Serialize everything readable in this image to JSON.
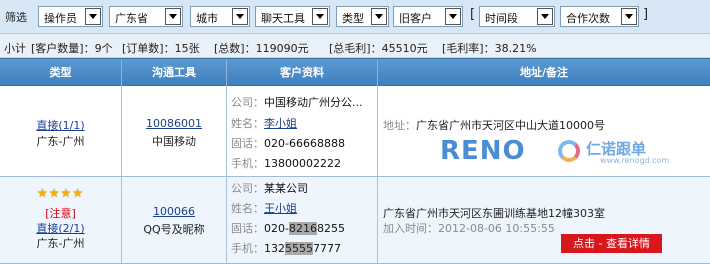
{
  "filters": {
    "label": "筛选",
    "selects": [
      {
        "value": "操作员"
      },
      {
        "value": "广东省"
      },
      {
        "value": "城市"
      },
      {
        "value": "聊天工具"
      },
      {
        "value": "类型"
      },
      {
        "value": "旧客户"
      }
    ],
    "bracket_open": "[",
    "time_select": {
      "value": "时间段"
    },
    "count_select": {
      "value": "合作次数"
    },
    "bracket_close": "]"
  },
  "summary": {
    "label": "小计",
    "customers": "[客户数量]：9个",
    "orders": "[订单数]：15张",
    "total": "[总数]：119090元",
    "profit": "[总毛利]：45510元",
    "margin": "[毛利率]：38.21%"
  },
  "columns": [
    "类型",
    "沟通工具",
    "客户资料",
    "地址/备注"
  ],
  "rows": [
    {
      "type_link": "直接(1/1)",
      "region": "广东-广州",
      "tool_id": "10086001",
      "tool_name": "中国移动",
      "company_key": "公司：",
      "company": "中国移动广州分公...",
      "name_key": "姓名：",
      "name": "李小姐",
      "phone_key": "固话：",
      "phone": "020-66668888",
      "mobile_key": "手机：",
      "mobile": "13800002222",
      "address_key": "地址：",
      "address": "广东省广州市天河区中山大道10000号",
      "logo_text": "RENO",
      "logo_cn": "仁诺跟单",
      "logo_url": "www.renogd.com"
    },
    {
      "stars": "★★★★",
      "tag": "[注意]",
      "type_link": "直接(2/1)",
      "region": "广东-广州",
      "tool_id": "100066",
      "tool_name": "QQ号及昵称",
      "company_key": "公司：",
      "company": "某某公司",
      "name_key": "姓名：",
      "name": "王小姐",
      "phone_key": "固话：",
      "phone_a": "020-",
      "phone_b": "8216",
      "phone_c": "8255",
      "mobile_key": "手机：",
      "mobile_a": "132",
      "mobile_b": "5555",
      "mobile_c": "7777",
      "address": "广东省广州市天河区东圃训练基地12幢303室",
      "join_key": "加入时间：",
      "join_time": "2012-08-06 10:55:55",
      "detail_button": "点击 - 查看详情"
    }
  ]
}
